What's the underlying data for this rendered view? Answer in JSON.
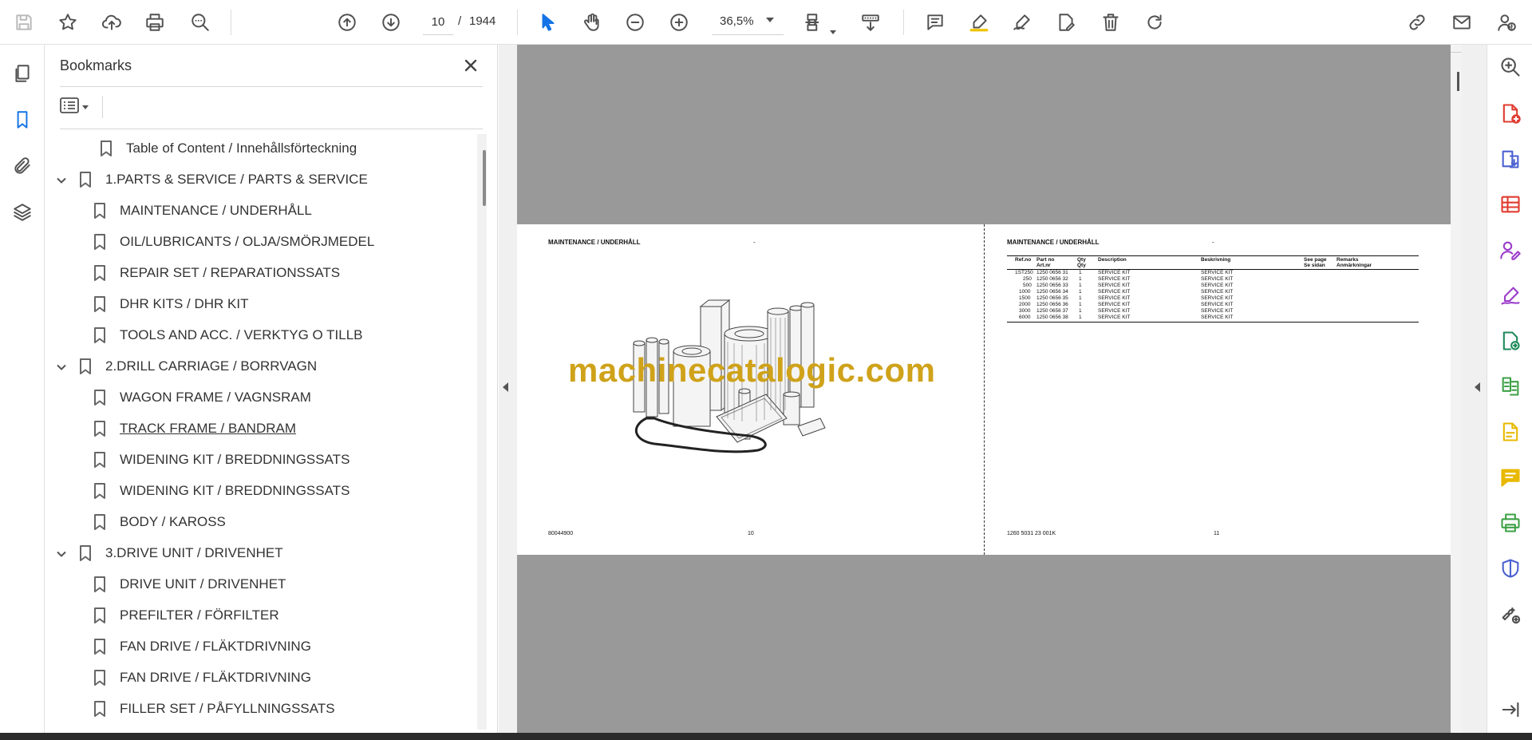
{
  "toolbar": {
    "current_page": "10",
    "page_separator": "/",
    "total_pages": "1944",
    "zoom": "36,5%",
    "icons": [
      "save-icon",
      "bookmark-star-icon",
      "upload-cloud-icon",
      "print-icon",
      "search-zoom-icon",
      "page-up-icon",
      "page-down-icon",
      "select-cursor-icon",
      "hand-pan-icon",
      "zoom-out-icon",
      "zoom-in-icon",
      "page-fit-icon",
      "scroll-mode-icon",
      "comment-icon",
      "highlight-icon",
      "draw-sign-icon",
      "fill-sign-icon",
      "delete-icon",
      "rotate-icon",
      "share-link-icon",
      "email-icon",
      "account-help-icon"
    ]
  },
  "left_rail": {
    "icons": [
      "page-thumbnails-icon",
      "bookmarks-icon",
      "attachments-icon",
      "layers-icon"
    ]
  },
  "bookmarks": {
    "title": "Bookmarks",
    "items": [
      {
        "label": "Table of Content / Innehållsförteckning",
        "level": 0,
        "expandable": false
      },
      {
        "label": "1.PARTS & SERVICE / PARTS & SERVICE",
        "level": 0,
        "expandable": true
      },
      {
        "label": "MAINTENANCE / UNDERHÅLL",
        "level": 1,
        "expandable": false
      },
      {
        "label": "OIL/LUBRICANTS / OLJA/SMÖRJMEDEL",
        "level": 1,
        "expandable": false
      },
      {
        "label": "REPAIR SET / REPARATIONSSATS",
        "level": 1,
        "expandable": false
      },
      {
        "label": "DHR KITS / DHR KIT",
        "level": 1,
        "expandable": false
      },
      {
        "label": "TOOLS AND ACC. / VERKTYG O TILLB",
        "level": 1,
        "expandable": false
      },
      {
        "label": "2.DRILL CARRIAGE / BORRVAGN",
        "level": 0,
        "expandable": true
      },
      {
        "label": "WAGON FRAME / VAGNSRAM",
        "level": 1,
        "expandable": false
      },
      {
        "label": "TRACK FRAME / BANDRAM",
        "level": 1,
        "expandable": false,
        "hover": true
      },
      {
        "label": "WIDENING KIT / BREDDNINGSSATS",
        "level": 1,
        "expandable": false
      },
      {
        "label": "WIDENING KIT / BREDDNINGSSATS",
        "level": 1,
        "expandable": false
      },
      {
        "label": "BODY / KAROSS",
        "level": 1,
        "expandable": false
      },
      {
        "label": "3.DRIVE UNIT / DRIVENHET",
        "level": 0,
        "expandable": true
      },
      {
        "label": "DRIVE UNIT / DRIVENHET",
        "level": 1,
        "expandable": false
      },
      {
        "label": "PREFILTER / FÖRFILTER",
        "level": 1,
        "expandable": false
      },
      {
        "label": "FAN DRIVE / FLÄKTDRIVNING",
        "level": 1,
        "expandable": false
      },
      {
        "label": "FAN DRIVE / FLÄKTDRIVNING",
        "level": 1,
        "expandable": false
      },
      {
        "label": "FILLER SET / PÅFYLLNINGSSATS",
        "level": 1,
        "expandable": false
      }
    ]
  },
  "document": {
    "left_page": {
      "header": "MAINTENANCE / UNDERHÅLL",
      "header_dash": "-",
      "footer_code": "80044900",
      "footer_page": "10"
    },
    "right_page": {
      "header": "MAINTENANCE / UNDERHÅLL",
      "header_dash": "-",
      "footer_code": "1260 5031 23 001K",
      "footer_page": "11",
      "table": {
        "headers": [
          {
            "top": "Ref.no",
            "bottom": ""
          },
          {
            "top": "Part no",
            "bottom": "Art.nr"
          },
          {
            "top": "Qty",
            "bottom": "Qty"
          },
          {
            "top": "Description",
            "bottom": ""
          },
          {
            "top": "Beskrivning",
            "bottom": ""
          },
          {
            "top": "See page",
            "bottom": "Se sidan"
          },
          {
            "top": "Remarks",
            "bottom": "Anmärkningar"
          }
        ],
        "rows": [
          [
            "1ST250",
            "1250 0656 31",
            "1",
            "SERVICE KIT",
            "SERVICE KIT"
          ],
          [
            "250",
            "1250 0656 32",
            "1",
            "SERVICE KIT",
            "SERVICE KIT"
          ],
          [
            "500",
            "1250 0656 33",
            "1",
            "SERVICE KIT",
            "SERVICE KIT"
          ],
          [
            "1000",
            "1250 0656 34",
            "1",
            "SERVICE KIT",
            "SERVICE KIT"
          ],
          [
            "1500",
            "1250 0656 35",
            "1",
            "SERVICE KIT",
            "SERVICE KIT"
          ],
          [
            "2000",
            "1250 0656 36",
            "1",
            "SERVICE KIT",
            "SERVICE KIT"
          ],
          [
            "3000",
            "1250 0656 37",
            "1",
            "SERVICE KIT",
            "SERVICE KIT"
          ],
          [
            "6000",
            "1250 0656 38",
            "1",
            "SERVICE KIT",
            "SERVICE KIT"
          ]
        ]
      }
    },
    "watermark": "machinecatalogic.com"
  },
  "right_rail": {
    "tools": [
      {
        "icon": "search-tools-icon",
        "color": "#505050"
      },
      {
        "icon": "create-pdf-icon",
        "color": "#e03c31"
      },
      {
        "icon": "export-pdf-icon",
        "color": "#4b61d1"
      },
      {
        "icon": "organize-pages-icon",
        "color": "#e03c31"
      },
      {
        "icon": "request-signatures-icon",
        "color": "#9b3dca"
      },
      {
        "icon": "fill-sign-icon",
        "color": "#9b3dca"
      },
      {
        "icon": "send-for-review-icon",
        "color": "#1f8a5b"
      },
      {
        "icon": "compare-files-icon",
        "color": "#3ea146"
      },
      {
        "icon": "edit-pdf-icon",
        "color": "#e8b900"
      },
      {
        "icon": "comment-tool-icon",
        "color": "#e8b900"
      },
      {
        "icon": "print-production-icon",
        "color": "#3ea146"
      },
      {
        "icon": "protect-icon",
        "color": "#4b61d1"
      },
      {
        "icon": "more-tools-icon",
        "color": "#505050"
      },
      {
        "icon": "expand-panel-icon",
        "color": "#505050"
      }
    ]
  }
}
